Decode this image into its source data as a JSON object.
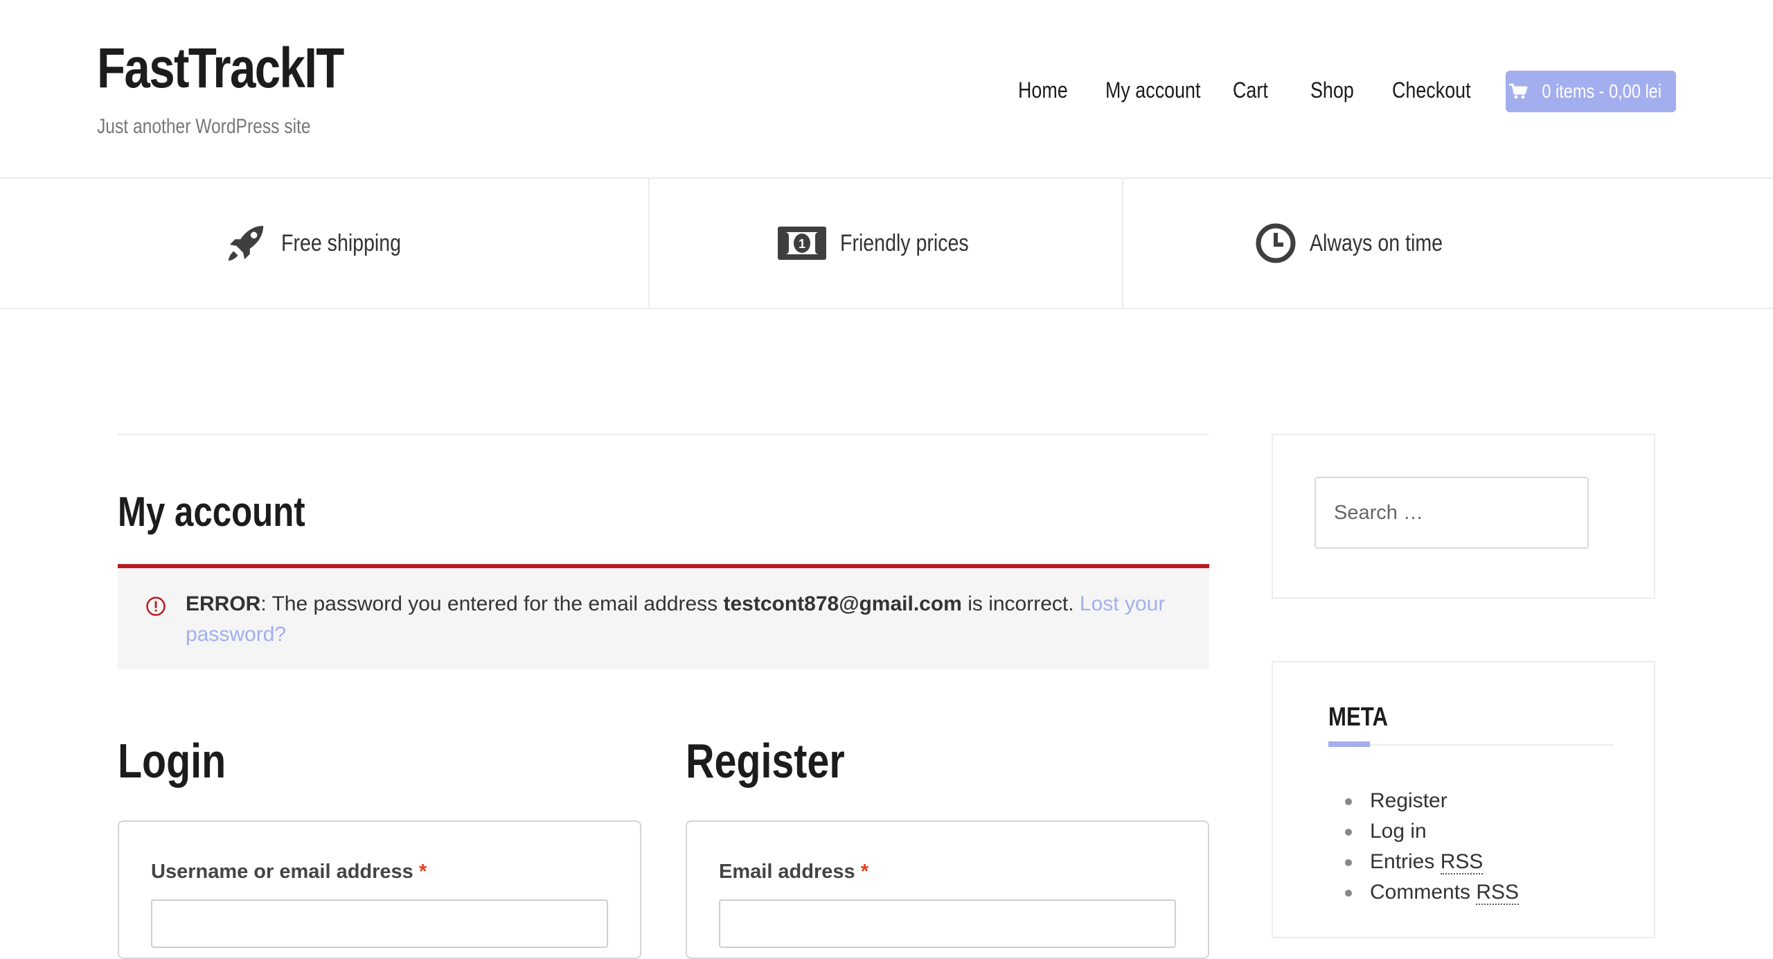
{
  "site": {
    "title": "FastTrackIT",
    "tagline": "Just another WordPress site"
  },
  "nav": {
    "items": [
      "Home",
      "My account",
      "Cart",
      "Shop",
      "Checkout"
    ],
    "cart_label": "0 items - 0,00 lei"
  },
  "features": [
    {
      "label": "Free shipping",
      "icon": "rocket-icon"
    },
    {
      "label": "Friendly prices",
      "icon": "money-icon"
    },
    {
      "label": "Always on time",
      "icon": "clock-icon"
    }
  ],
  "page": {
    "title": "My account"
  },
  "error": {
    "prefix": "ERROR",
    "text_before": ": The password you entered for the email address ",
    "email": "testcont878@gmail.com",
    "text_after": " is incorrect. ",
    "link": "Lost your password?"
  },
  "login": {
    "heading": "Login",
    "username_label": "Username or email address",
    "required_mark": "*"
  },
  "register": {
    "heading": "Register",
    "email_label": "Email address",
    "required_mark": "*"
  },
  "sidebar": {
    "search_placeholder": "Search …",
    "meta_title": "META",
    "meta_links": [
      {
        "text": "Register",
        "abbr": ""
      },
      {
        "text": "Log in",
        "abbr": ""
      },
      {
        "text": "Entries ",
        "abbr": "RSS"
      },
      {
        "text": "Comments ",
        "abbr": "RSS"
      }
    ]
  },
  "colors": {
    "accent": "#a3aeee",
    "error_border": "#b81c23",
    "text_dark": "#1c1c1c"
  }
}
